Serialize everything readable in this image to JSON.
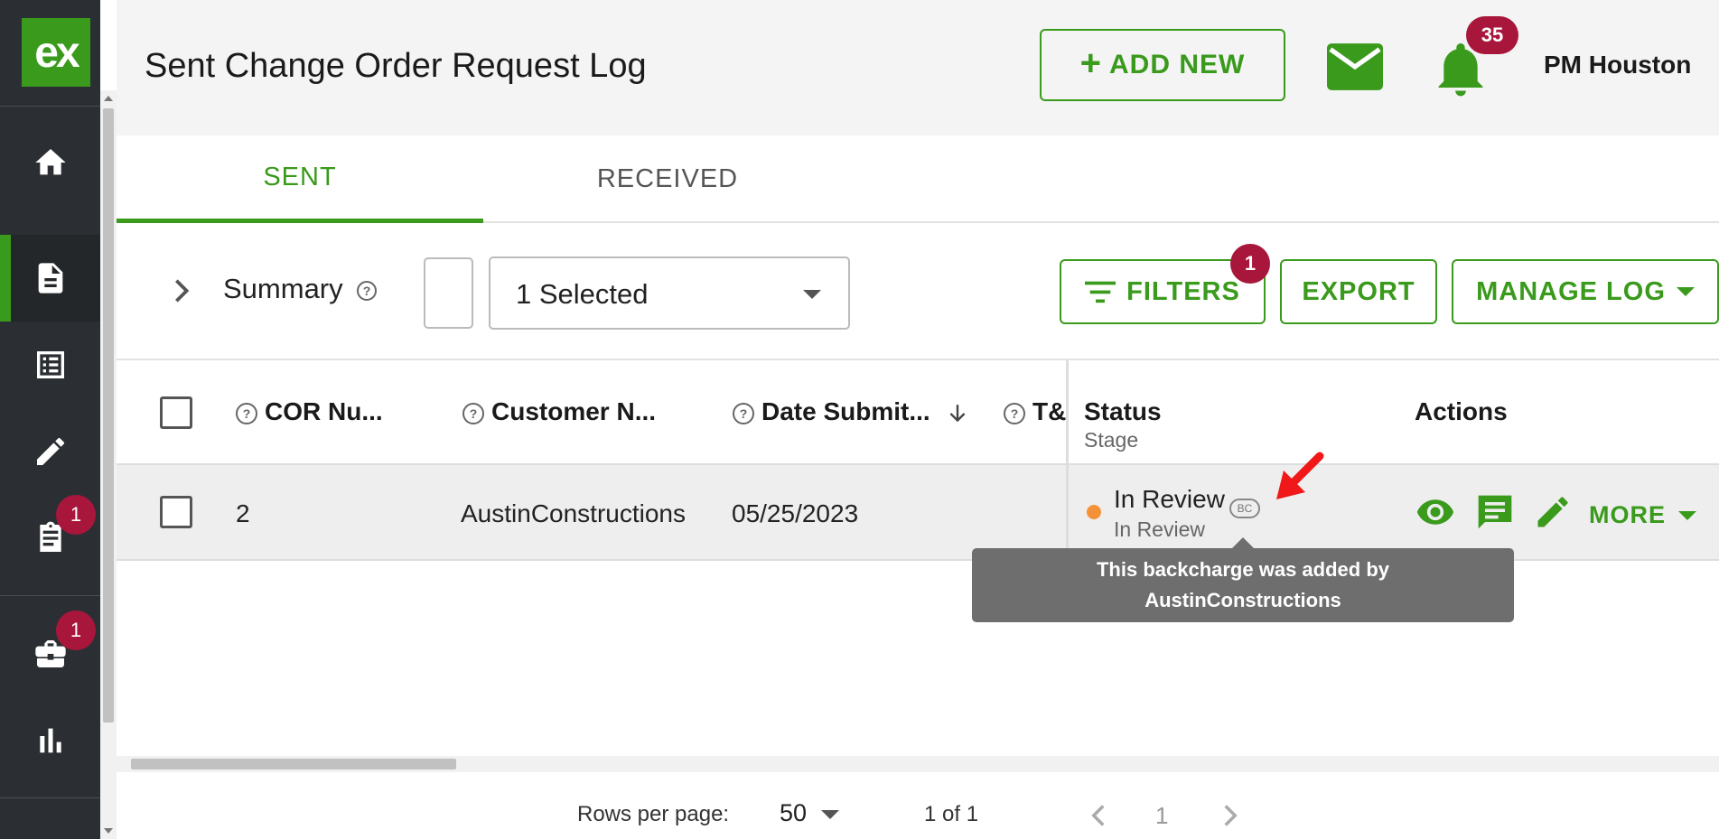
{
  "app": {
    "logo_text": "ex",
    "accent_color": "#3a9a1c",
    "badge_color": "#a8163c"
  },
  "sidebar": {
    "items": [
      {
        "name": "home-icon",
        "badge": ""
      },
      {
        "name": "document-icon",
        "badge": "",
        "active": true
      },
      {
        "name": "list-icon",
        "badge": ""
      },
      {
        "name": "pencil-icon",
        "badge": ""
      },
      {
        "name": "clipboard-icon",
        "badge": "1"
      },
      {
        "name": "briefcase-icon",
        "badge": "1"
      },
      {
        "name": "bar-chart-icon",
        "badge": ""
      }
    ]
  },
  "header": {
    "title": "Sent Change Order Request Log",
    "add_new_label": "ADD NEW",
    "notifications_count": "35",
    "user_name": "PM Houston"
  },
  "tabs": [
    {
      "label": "SENT",
      "active": true
    },
    {
      "label": "RECEIVED",
      "active": false
    }
  ],
  "toolbar": {
    "summary_label": "Summary",
    "select_value": "1 Selected",
    "filters_label": "FILTERS",
    "filters_badge": "1",
    "export_label": "EXPORT",
    "manage_log_label": "MANAGE LOG"
  },
  "table": {
    "columns": [
      {
        "label": "COR Nu..."
      },
      {
        "label": "Customer N..."
      },
      {
        "label": "Date Submit..."
      },
      {
        "label": "T&"
      },
      {
        "label": "Status",
        "sub": "Stage"
      },
      {
        "label": "Actions"
      }
    ],
    "rows": [
      {
        "cor_number": "2",
        "customer": "AustinConstructions",
        "date_submitted": "05/25/2023",
        "status": "In Review",
        "stage": "In Review",
        "backcharge_badge": "BC",
        "status_color": "#f4923a",
        "more_label": "MORE"
      }
    ]
  },
  "tooltip": {
    "text_line1": "This backcharge was added by",
    "text_line2": "AustinConstructions"
  },
  "pagination": {
    "rows_per_page_label": "Rows per page:",
    "rows_per_page_value": "50",
    "page_info": "1 of 1",
    "current_page": "1"
  }
}
